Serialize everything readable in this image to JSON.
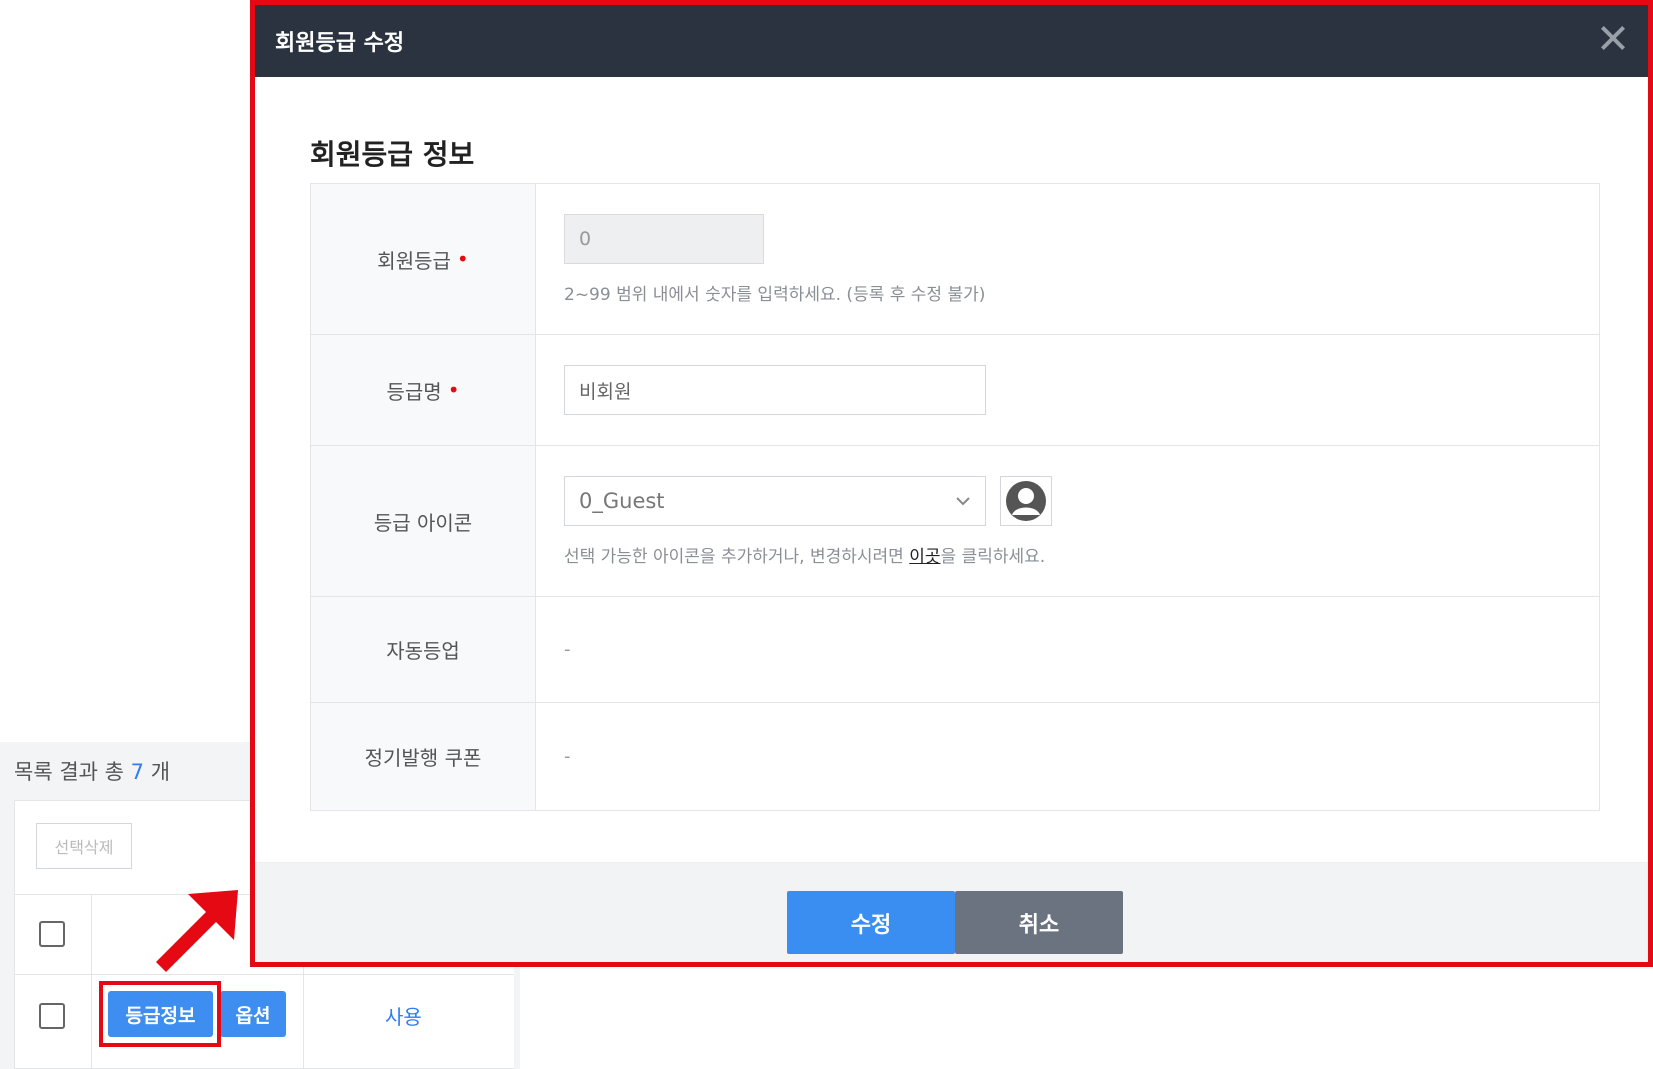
{
  "list": {
    "result_prefix": "목록 결과 총",
    "result_count": "7",
    "result_suffix": "개",
    "select_delete_label": "선택삭제",
    "grade_info_label": "등급정보",
    "option_label": "옵션",
    "use_label": "사용"
  },
  "modal": {
    "title": "회원등급 수정",
    "section_title": "회원등급 정보",
    "rows": {
      "grade": {
        "label": "회원등급",
        "required_mark": "•",
        "value": "0",
        "help": "2~99 범위 내에서 숫자를 입력하세요. (등록 후 수정 불가)"
      },
      "name": {
        "label": "등급명",
        "required_mark": "•",
        "value": "비회원"
      },
      "icon": {
        "label": "등급 아이콘",
        "selected": "0_Guest",
        "help_prefix": "선택 가능한 아이콘을 추가하거나, 변경하시려면 ",
        "help_link": "이곳",
        "help_suffix": "을 클릭하세요."
      },
      "auto_upgrade": {
        "label": "자동등업",
        "value": "-"
      },
      "coupon": {
        "label": "정기발행 쿠폰",
        "value": "-"
      }
    },
    "submit_label": "수정",
    "cancel_label": "취소"
  },
  "colors": {
    "accent": "#3a8ef2",
    "highlight": "#e50914",
    "header_bg": "#2b3340",
    "cancel_bg": "#6b7280"
  },
  "icons": [
    "close-icon",
    "chevron-down-icon",
    "user-avatar-icon",
    "arrow-icon"
  ]
}
